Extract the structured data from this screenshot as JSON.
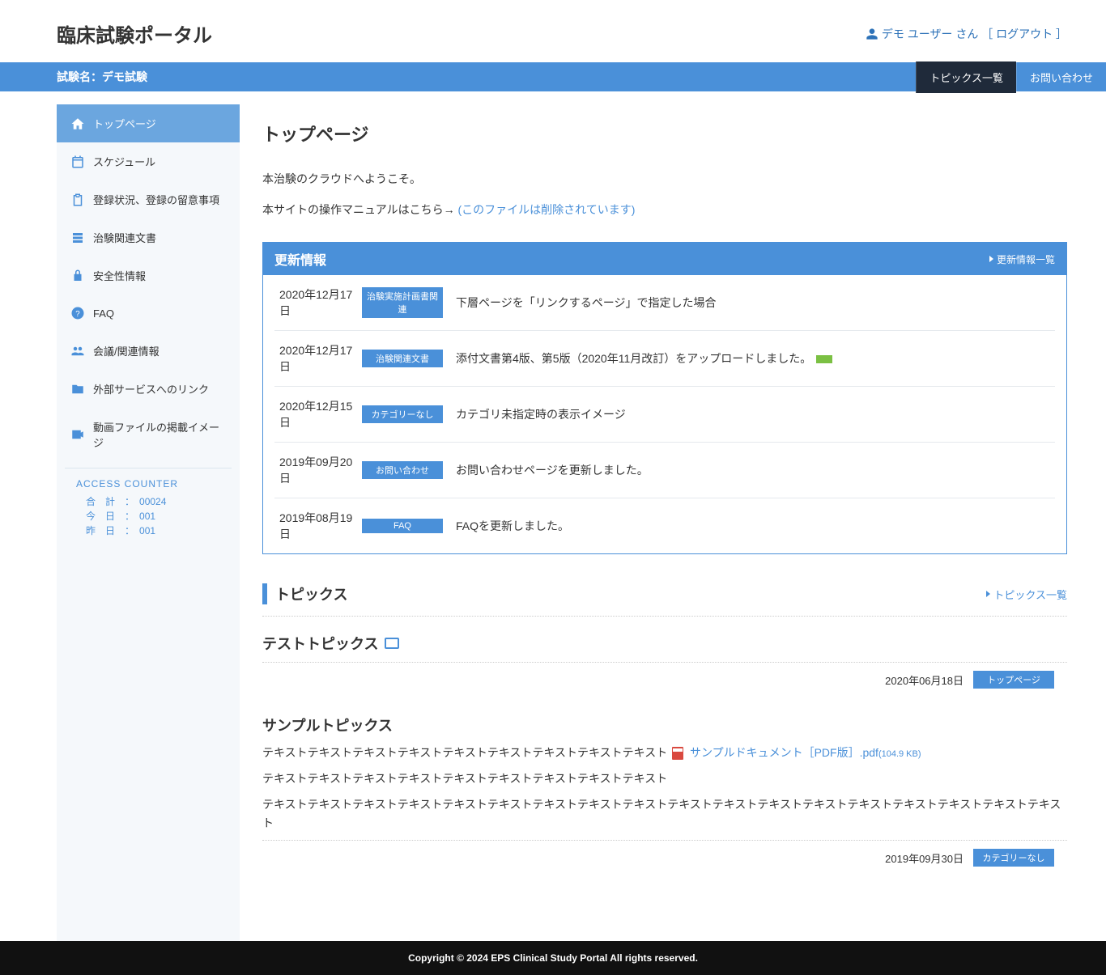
{
  "header": {
    "site_title": "臨床試験ポータル",
    "user_name": "デモ ユーザー さん",
    "logout_label": "［ ログアウト ］"
  },
  "subheader": {
    "trial_label": "試験名：デモ試験",
    "nav": {
      "topics_list": "トピックス一覧",
      "contact": "お問い合わせ"
    }
  },
  "sidebar": {
    "items": [
      "トップページ",
      "スケジュール",
      "登録状況、登録の留意事項",
      "治験関連文書",
      "安全性情報",
      "FAQ",
      "会議/関連情報",
      "外部サービスへのリンク",
      "動画ファイルの掲載イメージ"
    ],
    "counter": {
      "title": "ACCESS COUNTER",
      "total_label": "合　計",
      "total_value": "00024",
      "today_label": "今　日",
      "today_value": "001",
      "yesterday_label": "昨　日",
      "yesterday_value": "001"
    }
  },
  "main": {
    "page_title": "トップページ",
    "welcome": "本治験のクラウドへようこそ。",
    "manual_text": "本サイトの操作マニュアルはこちら→ ",
    "manual_link": "(このファイルは削除されています)",
    "updates": {
      "header": "更新情報",
      "list_link": "更新情報一覧",
      "rows": [
        {
          "date": "2020年12月17日",
          "badge": "治験実施計画書関連",
          "text": "下層ページを「リンクするページ」で指定した場合",
          "new": false
        },
        {
          "date": "2020年12月17日",
          "badge": "治験関連文書",
          "text": "添付文書第4版、第5版（2020年11月改訂）をアップロードしました。",
          "new": true
        },
        {
          "date": "2020年12月15日",
          "badge": "カテゴリーなし",
          "text": "カテゴリ未指定時の表示イメージ",
          "new": false
        },
        {
          "date": "2019年09月20日",
          "badge": "お問い合わせ",
          "text": "お問い合わせページを更新しました。",
          "new": false
        },
        {
          "date": "2019年08月19日",
          "badge": "FAQ",
          "text": "FAQを更新しました。",
          "new": false
        }
      ]
    },
    "topics_section": {
      "title": "トピックス",
      "list_link": "トピックス一覧"
    },
    "topic1": {
      "title": "テストトピックス",
      "date": "2020年06月18日",
      "badge": "トップページ"
    },
    "topic2": {
      "title": "サンプルトピックス",
      "line1": "テキストテキストテキストテキストテキストテキストテキストテキストテキスト",
      "file_name": "サンプルドキュメント［PDF版］.pdf",
      "file_size": "(104.9 KB)",
      "line2": "テキストテキストテキストテキストテキストテキストテキストテキストテキスト",
      "line3": "テキストテキストテキストテキストテキストテキストテキストテキストテキストテキストテキストテキストテキストテキストテキストテキストテキストテキスト",
      "date": "2019年09月30日",
      "badge": "カテゴリーなし"
    }
  },
  "footer": {
    "copyright": "Copyright © 2024 EPS Clinical Study Portal All rights reserved."
  }
}
